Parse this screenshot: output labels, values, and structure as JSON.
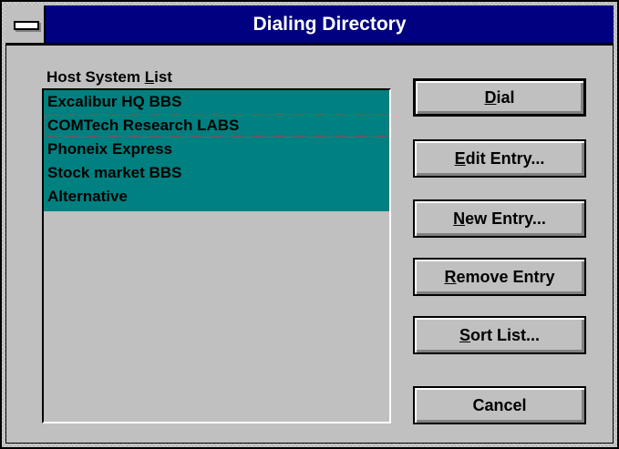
{
  "window": {
    "title": "Dialing Directory"
  },
  "list": {
    "label_pre": "Host System ",
    "label_mnemonic": "L",
    "label_post": "ist",
    "items": [
      "Excalibur HQ BBS",
      "COMTech Research LABS",
      "Phoneix Express",
      "Stock market BBS",
      "Alternative"
    ],
    "focused_index": 1
  },
  "buttons": {
    "dial": {
      "mnemonic": "D",
      "rest": "ial"
    },
    "edit": {
      "mnemonic": "E",
      "rest": "dit Entry..."
    },
    "new": {
      "mnemonic": "N",
      "rest": "ew Entry..."
    },
    "remove": {
      "mnemonic": "R",
      "rest": "emove Entry"
    },
    "sort": {
      "mnemonic": "S",
      "rest": "ort List..."
    },
    "cancel": {
      "label": "Cancel"
    }
  },
  "colors": {
    "titlebar": "#000080",
    "selection": "#008080",
    "face": "#c0c0c0"
  }
}
